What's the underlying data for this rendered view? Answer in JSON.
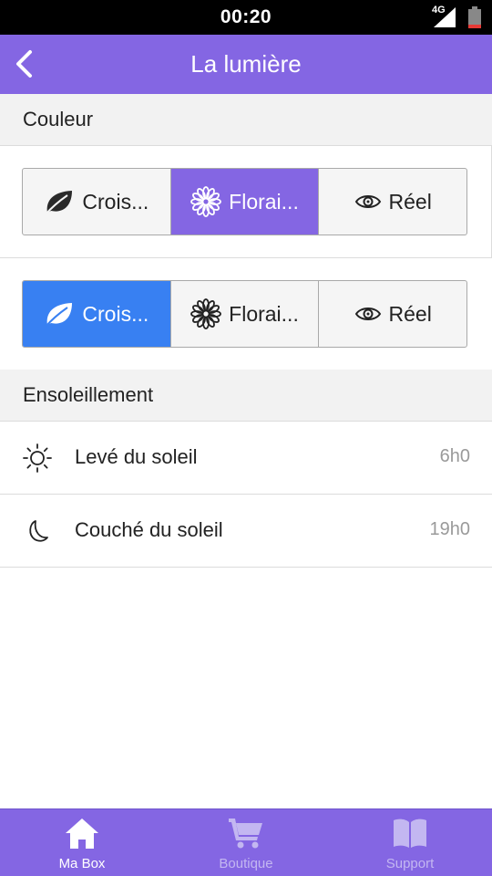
{
  "status_bar": {
    "time": "00:20",
    "network": "4G"
  },
  "app_bar": {
    "title": "La lumière"
  },
  "sections": {
    "color": {
      "title": "Couleur"
    },
    "sun": {
      "title": "Ensoleillement"
    }
  },
  "color_groups": [
    {
      "options": [
        {
          "label": "Crois...",
          "icon": "leaf-icon"
        },
        {
          "label": "Florai...",
          "icon": "flower-icon",
          "selected": true
        },
        {
          "label": "Réel",
          "icon": "eye-icon"
        }
      ],
      "selected_color": "#8466e3"
    },
    {
      "options": [
        {
          "label": "Crois...",
          "icon": "leaf-icon",
          "selected": true
        },
        {
          "label": "Florai...",
          "icon": "flower-icon"
        },
        {
          "label": "Réel",
          "icon": "eye-icon"
        }
      ],
      "selected_color": "#3880f2"
    }
  ],
  "sun_rows": [
    {
      "label": "Levé du soleil",
      "value": "6h0",
      "icon": "sun-icon"
    },
    {
      "label": "Couché du soleil",
      "value": "19h0",
      "icon": "moon-icon"
    }
  ],
  "tab_bar": {
    "tabs": [
      {
        "label": "Ma Box",
        "icon": "home-icon",
        "active": true
      },
      {
        "label": "Boutique",
        "icon": "cart-icon"
      },
      {
        "label": "Support",
        "icon": "book-icon"
      }
    ]
  },
  "colors": {
    "primary": "#8466e3",
    "blue": "#3880f2",
    "muted": "#9a9a9a"
  }
}
